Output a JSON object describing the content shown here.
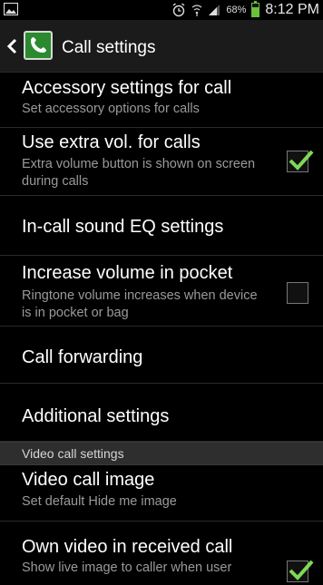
{
  "status_bar": {
    "battery_percent": "68%",
    "battery_level": 0.68,
    "time": "8:12 PM",
    "icons": [
      "gallery-icon",
      "alarm-icon",
      "wifi-icon",
      "signal-icon",
      "battery-icon"
    ]
  },
  "action_bar": {
    "title": "Call settings",
    "app_icon": "phone-icon",
    "accent_color": "#2b8a2f"
  },
  "items": {
    "accessory": {
      "title": "Accessory settings for call",
      "subtitle": "Set accessory options for calls"
    },
    "extra_vol": {
      "title": "Use extra vol. for calls",
      "subtitle": "Extra volume button is shown on screen during calls",
      "checked": true
    },
    "sound_eq": {
      "title": "In-call sound EQ settings"
    },
    "pocket": {
      "title": "Increase volume in pocket",
      "subtitle": "Ringtone volume increases when device is in pocket or bag",
      "checked": false
    },
    "forwarding": {
      "title": "Call forwarding"
    },
    "additional": {
      "title": "Additional settings"
    },
    "video_section": {
      "label": "Video call settings"
    },
    "video_image": {
      "title": "Video call image",
      "subtitle": "Set default Hide me image"
    },
    "own_video": {
      "title": "Own video in received call",
      "subtitle": "Show live image to caller when user",
      "checked": true
    }
  },
  "checkmark_color": "#7ed957"
}
